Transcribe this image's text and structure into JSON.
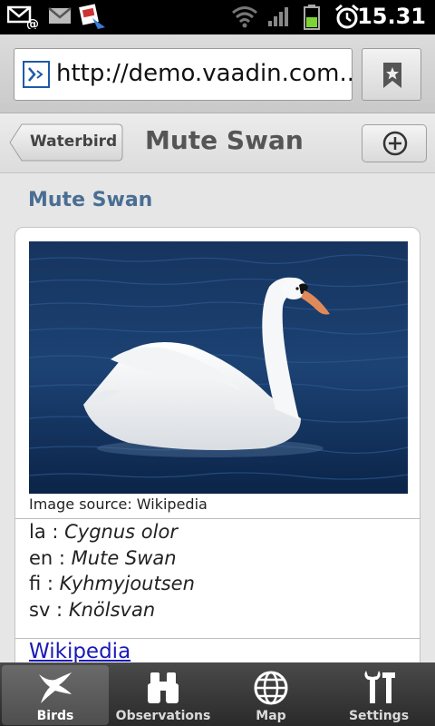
{
  "status_bar": {
    "time": "15.31",
    "icons": [
      "email-notification-icon",
      "gmail-icon",
      "message-icon",
      "wifi-icon",
      "signal-icon",
      "battery-icon",
      "alarm-icon"
    ]
  },
  "browser": {
    "url": "http://demo.vaadin.com...",
    "bookmark_icon": "bookmark-icon"
  },
  "nav": {
    "back_label": "Waterbird",
    "title": "Mute Swan",
    "add_icon": "add-icon"
  },
  "content": {
    "section_title": "Mute Swan",
    "image_source": "Image source: Wikipedia",
    "names": [
      {
        "lang": "la",
        "sep": " : ",
        "value": "Cygnus olor"
      },
      {
        "lang": "en",
        "sep": " : ",
        "value": "Mute Swan"
      },
      {
        "lang": "fi",
        "sep": " : ",
        "value": "Kyhmyjoutsen"
      },
      {
        "lang": "sv",
        "sep": " : ",
        "value": "Knölsvan"
      }
    ],
    "link_label": "Wikipedia"
  },
  "tabs": [
    {
      "label": "Birds",
      "icon": "bird-icon",
      "active": true
    },
    {
      "label": "Observations",
      "icon": "binoculars-icon",
      "active": false
    },
    {
      "label": "Map",
      "icon": "globe-icon",
      "active": false
    },
    {
      "label": "Settings",
      "icon": "tools-icon",
      "active": false
    }
  ],
  "colors": {
    "accent_title": "#4a6e94",
    "link": "#1a1ab8",
    "tabbar": "#3a3a3a"
  }
}
